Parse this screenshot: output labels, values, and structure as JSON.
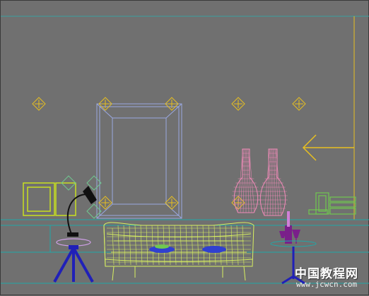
{
  "viewport": {
    "name": "front-viewport",
    "background": "#707070",
    "colors": {
      "light_helper": "#e8c020",
      "frame_wire": "#9aa8e0",
      "vase_wire": "#f08ab8",
      "sofa_wire": "#d8f060",
      "lamp": "#101010",
      "table_legs": "#2020b8",
      "books": "#70c850",
      "shelf_line": "#20a8a8",
      "bowl": "#3040d0",
      "arrow": "#e8c020",
      "wine": "#7a1f8a"
    }
  },
  "watermark": {
    "line1": "中国教程网",
    "line2": "www.jcwcn.com"
  }
}
